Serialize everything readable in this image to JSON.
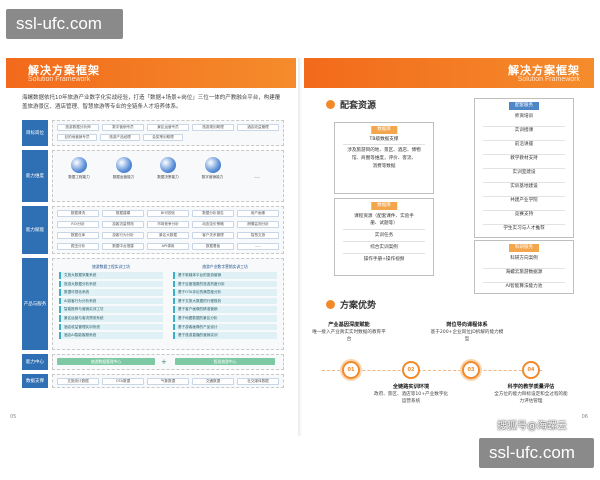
{
  "watermark": {
    "text": "ssl-ufc.com"
  },
  "left_page": {
    "title": "解决方案框架",
    "subtitle": "Solution Framework",
    "intro": "海螺数据依托10年旅游产业数字化实战经验，打造「数据+场景+岗位」三位一体的产教融合平台，构建覆盖旅游景区、酒店管理、智慧旅游等专业的全链条人才培养体系。",
    "page_number": "05",
    "layers": [
      {
        "label": "目标岗位",
        "chips": [
          [
            "旅游数据分析师",
            "数字营销专员",
            "景区运营专员",
            "旅游规划助理",
            "酒店收益管理"
          ],
          [
            "目的地营销专员",
            "旅游产品经理",
            "会奖策划助理",
            "",
            ""
          ]
        ]
      },
      {
        "label": "能力维度",
        "icons": [
          "数据工程能力",
          "数据运营能力",
          "数据决策能力",
          "数字营销能力",
          "......"
        ]
      },
      {
        "label": "能力赋能",
        "chips": [
          [
            "数据清洗",
            "数据建模",
            "BI可视化",
            "数据分析报告",
            "用户画像"
          ],
          [
            "ROI分析",
            "游客流量预测",
            "市场竞争分析",
            "动态定价策略",
            "舆情监测分析"
          ],
          [
            "数据仓库",
            "游客行为分析",
            "景区大数据",
            "客户关系管理",
            "智慧文旅"
          ],
          [
            "爬虫分析",
            "数据中台搭建",
            "API调用",
            "数据看板",
            "......"
          ]
        ]
      },
      {
        "label": "产品与服务",
        "col_a_head": "旅游数据工程实训工坊",
        "col_a": [
          "文旅大数据采集系统",
          "旅游大数据分析系统",
          "数据可视化系统",
          "AI游客行为分析系统",
          "智能推荐与营销实训工坊",
          "景区运营与客流预测系统",
          "酒店收益管理实训系统",
          "酒店AI智能客服系统"
        ],
        "col_b_head": "旅游产业数字营销实训工坊",
        "col_b": [
          "基于新媒体平台的旅游营销",
          "基于百度指数的旅游热度分析",
          "基于OTA评论的满意度分析",
          "基于文旅大数据的行程规划",
          "基于客户画像的精准营销",
          "基于地图数据的景区分析",
          "基于游客画像的产品设计",
          "基于旅游直播的营销实训"
        ]
      },
      {
        "label": "能力中心",
        "bars": [
          "旅游数据管理中心",
          "智慧旅游中心"
        ]
      },
      {
        "label": "数据支撑",
        "chips": [
          [
            "文旅统计数据",
            "OTA数据",
            "气象数据",
            "交通数据",
            "社交媒体数据"
          ]
        ]
      }
    ]
  },
  "right_page": {
    "title": "解决方案框架",
    "subtitle": "Solution Framework",
    "page_number": "06",
    "resources_title": "配套资源",
    "tb_box": {
      "title": "数据库",
      "lines": [
        "TB级数据支撑",
        "涉及旅游目的地、景区、酒店、博物",
        "馆、商圈等维度，评价、客流、",
        "消费等数据"
      ]
    },
    "course_box": {
      "title": "数据库",
      "lines": [
        "课程资源（配套课件、实验手",
        "册、试题等）",
        "实训任务",
        "综合实训案例",
        "操作手册+操作视频"
      ]
    },
    "service_box": {
      "title": "配套服务",
      "lines": [
        "师资培训",
        "实训授课",
        "前沿讲座",
        "教学教材支持",
        "实训室建设",
        "实训基地建设",
        "共建产业学院",
        "竞赛支持",
        "学生实习与人才推荐"
      ]
    },
    "research_box": {
      "title": "科研服务",
      "lines": [
        "科研方向案例",
        "海螺云旅游数据源",
        "AI智能算法能力池"
      ]
    },
    "advantages_title": "方案优势",
    "advantages": [
      {
        "num": "01",
        "title": "产业基因深度赋能",
        "desc": "唯一接入产业真实实时数据的教育平台",
        "pos": "top"
      },
      {
        "num": "02",
        "title": "全链路实训环境",
        "desc": "政府、景区、酒店等10+产业数字化运营系统",
        "pos": "bottom"
      },
      {
        "num": "03",
        "title": "岗位导向课程体系",
        "desc": "基于200+企业岗位JD拆解的能力模型",
        "pos": "top"
      },
      {
        "num": "04",
        "title": "科学的教学质量评估",
        "desc": "全方位的能力目标设定和全过程的能力评估管理",
        "pos": "bottom"
      }
    ]
  },
  "footer_credit": "搜狐号@海螺云",
  "colors": {
    "accent": "#f26a1b",
    "blue": "#2f6fb3",
    "teal": "#3ab1c8",
    "green": "#7cc9a3"
  }
}
